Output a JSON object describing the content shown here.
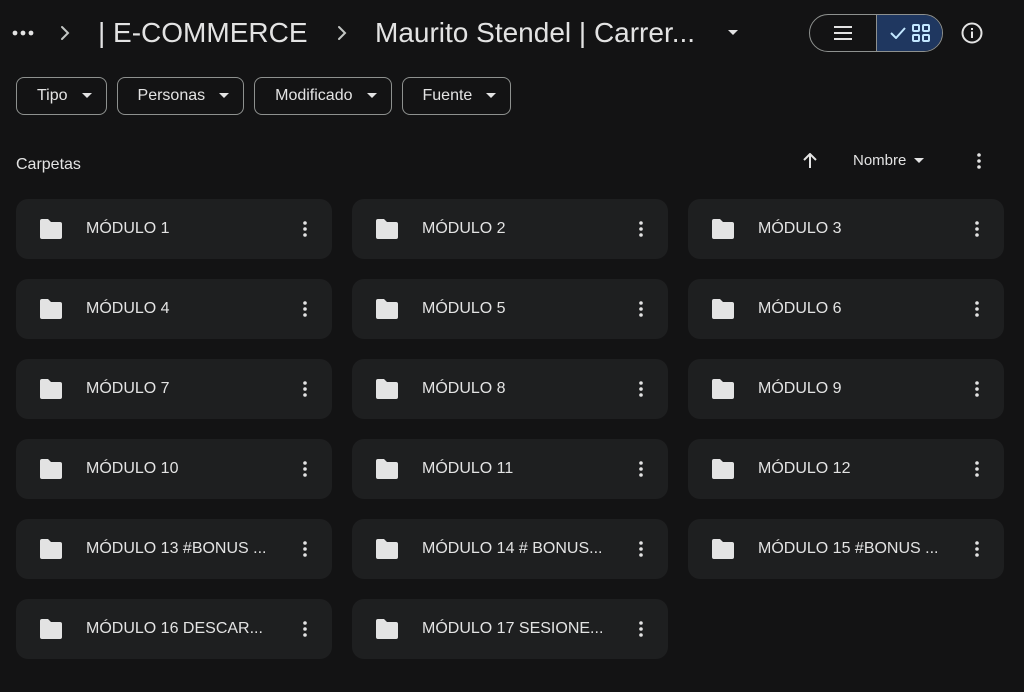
{
  "breadcrumb": {
    "parent": "| E-COMMERCE",
    "current": "Maurito Stendel | Carrer..."
  },
  "view_toggle": {
    "list_icon": "list-icon",
    "grid_icon": "grid-icon",
    "active": "grid"
  },
  "filters": [
    {
      "label": "Tipo"
    },
    {
      "label": "Personas"
    },
    {
      "label": "Modificado"
    },
    {
      "label": "Fuente"
    }
  ],
  "section": {
    "title": "Carpetas",
    "sort_label": "Nombre"
  },
  "folders": [
    {
      "name": "MÓDULO 1"
    },
    {
      "name": "MÓDULO 2"
    },
    {
      "name": "MÓDULO 3"
    },
    {
      "name": "MÓDULO 4"
    },
    {
      "name": "MÓDULO 5"
    },
    {
      "name": "MÓDULO 6"
    },
    {
      "name": "MÓDULO 7"
    },
    {
      "name": "MÓDULO 8"
    },
    {
      "name": "MÓDULO 9"
    },
    {
      "name": "MÓDULO 10"
    },
    {
      "name": "MÓDULO 11"
    },
    {
      "name": "MÓDULO 12"
    },
    {
      "name": "MÓDULO 13 #BONUS ..."
    },
    {
      "name": "MÓDULO 14 # BONUS..."
    },
    {
      "name": "MÓDULO 15 #BONUS ..."
    },
    {
      "name": "MÓDULO 16 DESCAR..."
    },
    {
      "name": "MÓDULO 17 SESIONE..."
    }
  ],
  "colors": {
    "background": "#131314",
    "card": "#1e1f20",
    "text": "#e3e3e3",
    "outline": "#8e918f",
    "active_toggle": "#1f3760",
    "active_icon": "#c2e7ff"
  }
}
